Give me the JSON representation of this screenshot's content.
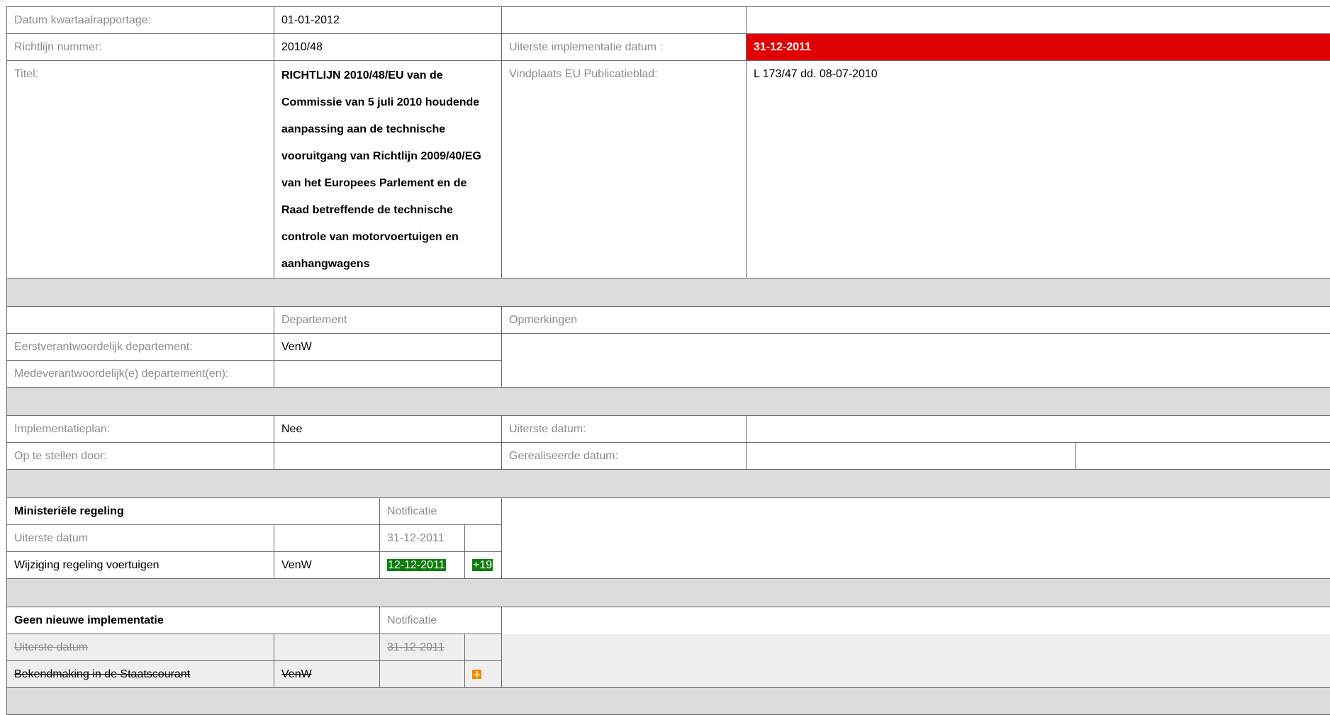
{
  "header": {
    "datum_label": "Datum kwartaalrapportage:",
    "datum_value": "01-01-2012",
    "richtlijn_label": "Richtlijn nummer:",
    "richtlijn_value": "2010/48",
    "uiterste_impl_label": "Uiterste implementatie datum :",
    "uiterste_impl_value": "31-12-2011",
    "titel_label": "Titel:",
    "titel_value": "RICHTLIJN 2010/48/EU van de Commissie van 5 juli 2010 houdende aanpassing aan de technische vooruitgang van Richtlijn 2009/40/EG van het Europees Parlement en de Raad betreffende de technische controle van motorvoertuigen en aanhangwagens",
    "vindplaats_label": "Vindplaats EU Publicatieblad:",
    "vindplaats_value": "L 173/47 dd. 08-07-2010"
  },
  "departementen": {
    "col_departement": "Departement",
    "col_opmerkingen": "Opmerkingen",
    "eerst_label": "Eerstverantwoordelijk departement:",
    "eerst_value": "VenW",
    "mede_label": "Medeverantwoordelijk(e) departement(en):",
    "mede_value": ""
  },
  "plan": {
    "impl_label": "Implementatieplan:",
    "impl_value": "Nee",
    "uiterste_label": "Uiterste datum:",
    "op_te_stellen_label": "Op te stellen door:",
    "gerealiseerd_label": "Gerealiseerde datum:"
  },
  "ministeriele": {
    "title": "Ministeriële regeling",
    "notificatie": "Notificatie",
    "uiterste_label": "Uiterste datum",
    "uiterste_date": "31-12-2011",
    "item_label": "Wijziging regeling voertuigen",
    "item_dept": "VenW",
    "item_date": "12-12-2011",
    "item_delta": "+19"
  },
  "geen_nieuwe": {
    "title": "Geen nieuwe implementatie",
    "notificatie": "Notificatie",
    "uiterste_label": "Uiterste datum",
    "uiterste_date": "31-12-2011",
    "item_label": "Bekendmaking in de Staatscourant",
    "item_dept": "VenW",
    "warn_icon": "warning-plus-icon"
  },
  "colors": {
    "red": "#e00000",
    "green": "#0a7d0a",
    "separator": "#dcdcdc",
    "orange": "#f28a00"
  }
}
